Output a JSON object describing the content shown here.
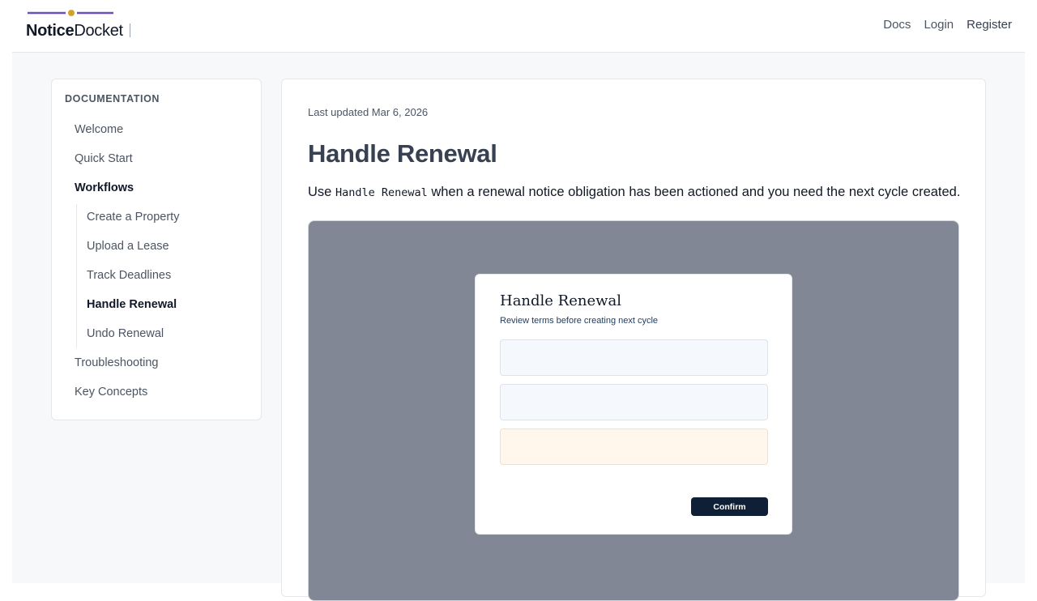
{
  "brand": {
    "name_bold": "Notice",
    "name_regular": "Docket",
    "accent_color": "#6d4fb8",
    "dot_color": "#d4a22c"
  },
  "nav": {
    "docs": "Docs",
    "login": "Login",
    "register": "Register"
  },
  "sidebar": {
    "title": "DOCUMENTATION",
    "items": [
      {
        "label": "Welcome"
      },
      {
        "label": "Quick Start"
      },
      {
        "label": "Workflows",
        "active": true
      },
      {
        "label": "Troubleshooting"
      },
      {
        "label": "Key Concepts"
      }
    ],
    "workflow_items": [
      {
        "label": "Create a Property"
      },
      {
        "label": "Upload a Lease"
      },
      {
        "label": "Track Deadlines"
      },
      {
        "label": "Handle Renewal",
        "current": true
      },
      {
        "label": "Undo Renewal"
      }
    ]
  },
  "article": {
    "updated": "Last updated Mar 6, 2026",
    "title": "Handle Renewal",
    "intro_prefix": "Use ",
    "intro_code": "Handle Renewal",
    "intro_suffix": " when a renewal notice obligation has been actioned and you need the next cycle created."
  },
  "figure": {
    "modal_title": "Handle Renewal",
    "modal_subtitle": "Review terms before creating next cycle",
    "confirm_label": "Confirm"
  }
}
